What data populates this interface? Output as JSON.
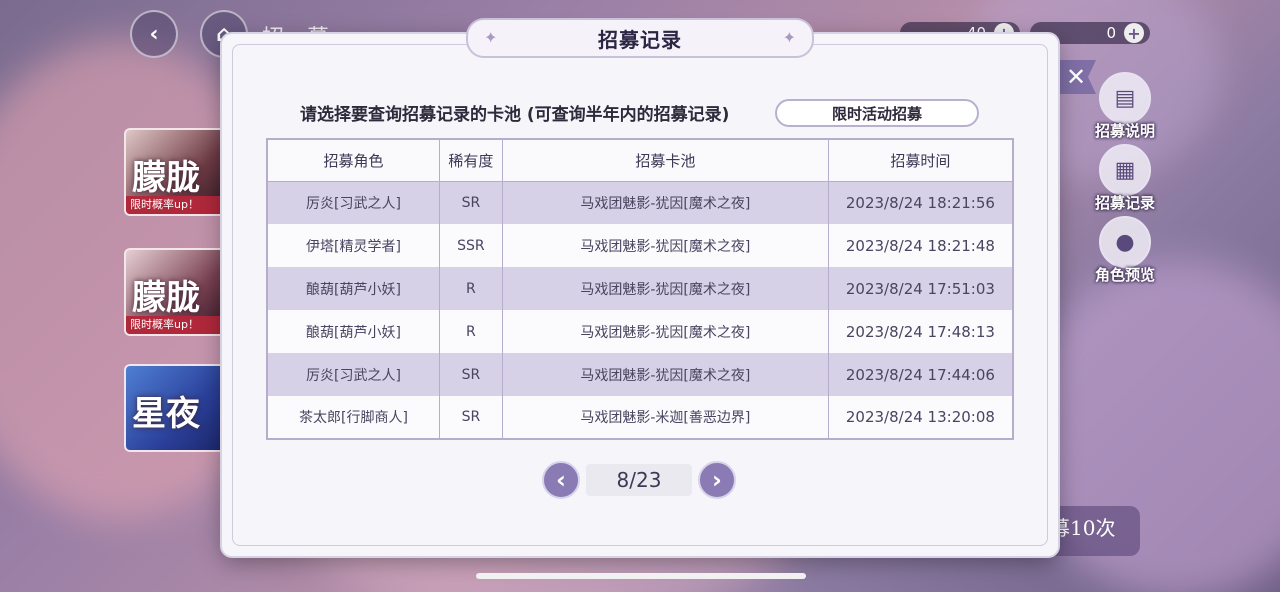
{
  "modal": {
    "title": "招募记录",
    "prompt": "请选择要查询招募记录的卡池 (可查询半年内的招募记录)",
    "pool_button": "限时活动招募",
    "columns": [
      "招募角色",
      "稀有度",
      "招募卡池",
      "招募时间"
    ],
    "rows": [
      {
        "character": "厉炎[习武之人]",
        "rarity": "SR",
        "pool": "马戏团魅影-犹因[魔术之夜]",
        "time": "2023/8/24 18:21:56"
      },
      {
        "character": "伊塔[精灵学者]",
        "rarity": "SSR",
        "pool": "马戏团魅影-犹因[魔术之夜]",
        "time": "2023/8/24 18:21:48"
      },
      {
        "character": "酿葫[葫芦小妖]",
        "rarity": "R",
        "pool": "马戏团魅影-犹因[魔术之夜]",
        "time": "2023/8/24 17:51:03"
      },
      {
        "character": "酿葫[葫芦小妖]",
        "rarity": "R",
        "pool": "马戏团魅影-犹因[魔术之夜]",
        "time": "2023/8/24 17:48:13"
      },
      {
        "character": "厉炎[习武之人]",
        "rarity": "SR",
        "pool": "马戏团魅影-犹因[魔术之夜]",
        "time": "2023/8/24 17:44:06"
      },
      {
        "character": "茶太郎[行脚商人]",
        "rarity": "SR",
        "pool": "马戏团魅影-米迦[善恶边界]",
        "time": "2023/8/24 13:20:08"
      }
    ],
    "pager": {
      "page_label": "8/23"
    }
  },
  "background": {
    "page_hint": "招 募",
    "currency_values": [
      "40",
      "0"
    ],
    "banners": [
      {
        "title": "朦胧",
        "tag": "限时概率up！"
      },
      {
        "title": "朦胧",
        "tag": "限时概率up！"
      },
      {
        "title": "星夜",
        "tag": ""
      }
    ],
    "side_buttons": [
      "招募说明",
      "招募记录",
      "角色预览"
    ],
    "recruit_ten": "募10次"
  },
  "colors": {
    "row_alt": "#d6d1e6",
    "accent": "#8a7bb5",
    "modal_bg": "#f6f5f9"
  },
  "icons": [
    "back-arrow-icon",
    "home-icon",
    "plus-icon",
    "close-icon",
    "chevron-left-icon",
    "chevron-right-icon",
    "document-icon",
    "cards-icon",
    "person-icon",
    "sparkle-icon"
  ]
}
